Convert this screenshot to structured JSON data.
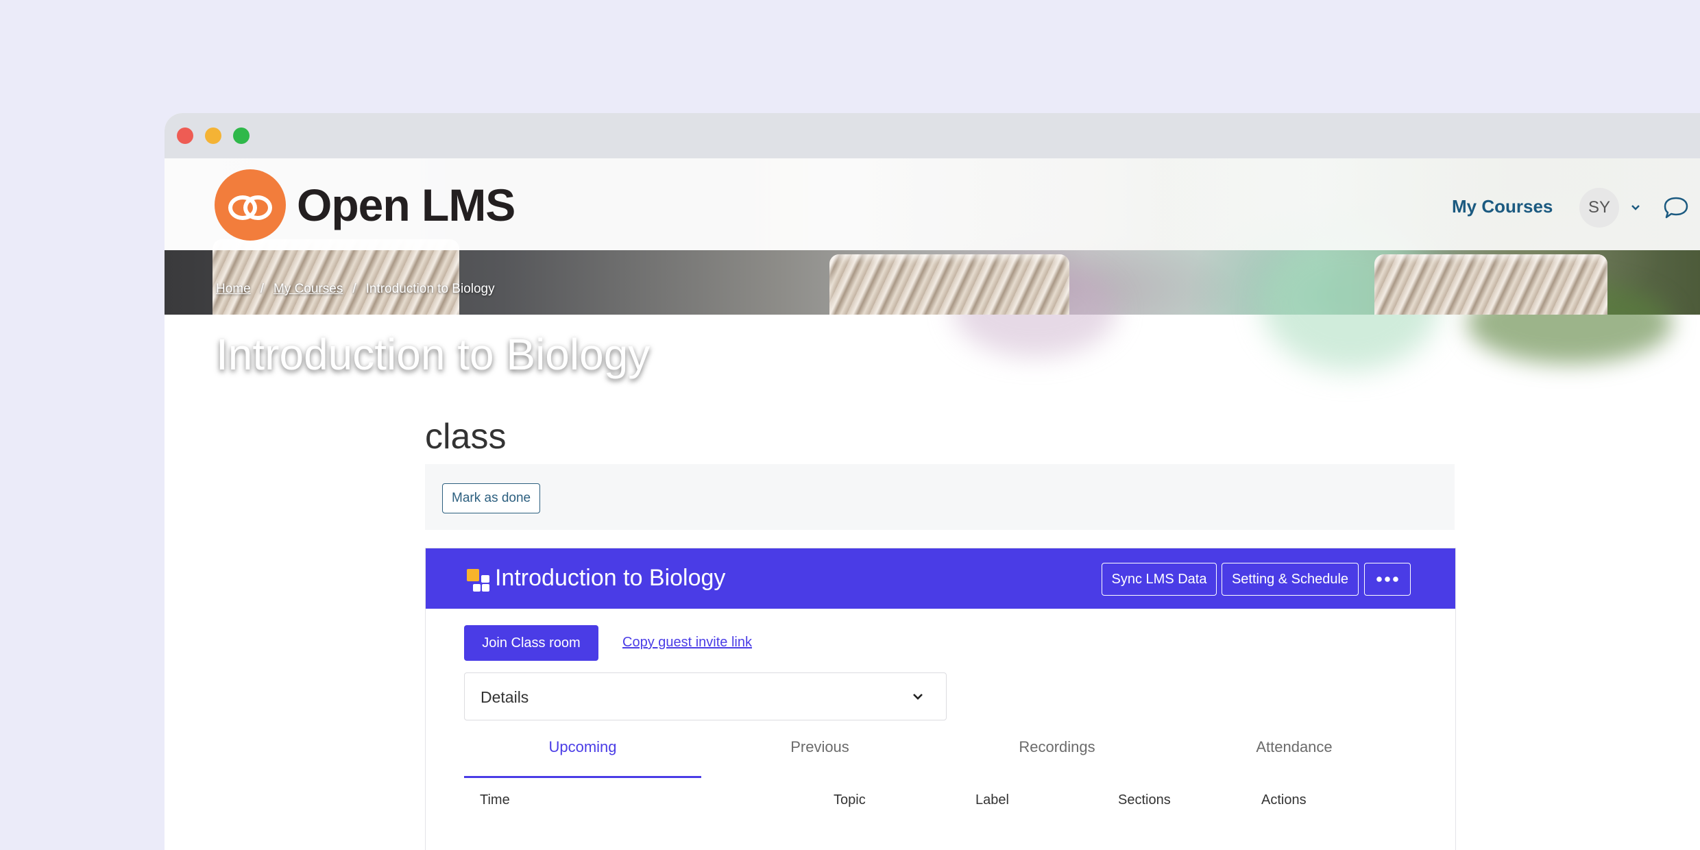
{
  "app": {
    "brand": "Open LMS",
    "accent": "#4a3ce6",
    "brand_orange": "#f27d3c",
    "nav_blue": "#1b5a80"
  },
  "header": {
    "my_courses": "My Courses",
    "avatar_initials": "SY",
    "icons": [
      "chevron-down-icon",
      "chat-icon"
    ]
  },
  "breadcrumb": {
    "items": [
      "Home",
      "My Courses",
      "Introduction to Biology"
    ],
    "separator": "/"
  },
  "hero": {
    "title": "Introduction to Biology"
  },
  "page": {
    "heading": "class"
  },
  "completion": {
    "mark_done": "Mark as done"
  },
  "card": {
    "title": "Introduction to Biology",
    "sync_label": "Sync LMS Data",
    "setting_label": "Setting & Schedule",
    "more_label": "•••",
    "join_label": "Join Class room",
    "copy_link_label": "Copy guest invite link",
    "details_label": "Details",
    "tabs": [
      "Upcoming",
      "Previous",
      "Recordings",
      "Attendance"
    ],
    "active_tab": "Upcoming",
    "columns": [
      "Time",
      "Topic",
      "Label",
      "Sections",
      "Actions"
    ]
  }
}
